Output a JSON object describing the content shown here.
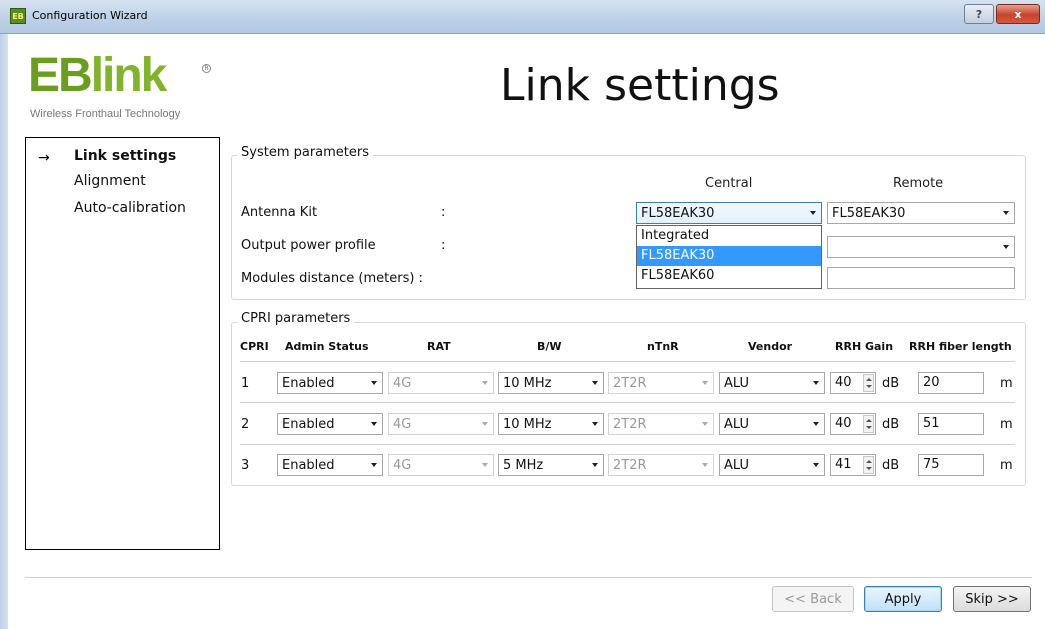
{
  "window": {
    "title": "Configuration Wizard",
    "app_icon_text": "EB",
    "help_label": "?",
    "close_label": "x"
  },
  "logo": {
    "brand_eb": "EB",
    "brand_link": "link",
    "reg_mark": "R",
    "tagline": "Wireless Fronthaul Technology"
  },
  "page_title": "Link settings",
  "nav": {
    "arrow": "→",
    "items": [
      {
        "label": "Link settings",
        "active": true
      },
      {
        "label": "Alignment",
        "active": false
      },
      {
        "label": "Auto-calibration",
        "active": false
      }
    ]
  },
  "system": {
    "title": "System parameters",
    "col_central": "Central",
    "col_remote": "Remote",
    "colon": ":",
    "rows": [
      {
        "label": "Antenna Kit",
        "central": "FL58EAK30",
        "remote": "FL58EAK30"
      },
      {
        "label": "Output power profile",
        "central": "",
        "remote": ""
      },
      {
        "label": "Modules distance (meters) :",
        "central": "",
        "remote": ""
      }
    ],
    "dropdown_options": [
      "Integrated",
      "FL58EAK30",
      "FL58EAK60"
    ],
    "dropdown_selected": "FL58EAK30"
  },
  "cpri": {
    "title": "CPRI parameters",
    "headers": [
      "CPRI",
      "Admin Status",
      "RAT",
      "B/W",
      "nTnR",
      "Vendor",
      "RRH Gain",
      "RRH fiber length"
    ],
    "gain_unit": "dB",
    "length_unit": "m",
    "rows": [
      {
        "num": "1",
        "admin": "Enabled",
        "rat": "4G",
        "bw": "10 MHz",
        "ntnr": "2T2R",
        "vendor": "ALU",
        "gain": "40",
        "length": "20"
      },
      {
        "num": "2",
        "admin": "Enabled",
        "rat": "4G",
        "bw": "10 MHz",
        "ntnr": "2T2R",
        "vendor": "ALU",
        "gain": "40",
        "length": "51"
      },
      {
        "num": "3",
        "admin": "Enabled",
        "rat": "4G",
        "bw": "5 MHz",
        "ntnr": "2T2R",
        "vendor": "ALU",
        "gain": "41",
        "length": "75"
      }
    ]
  },
  "footer": {
    "back_label": "<< Back",
    "apply_label": "Apply",
    "skip_label": "Skip >>"
  }
}
